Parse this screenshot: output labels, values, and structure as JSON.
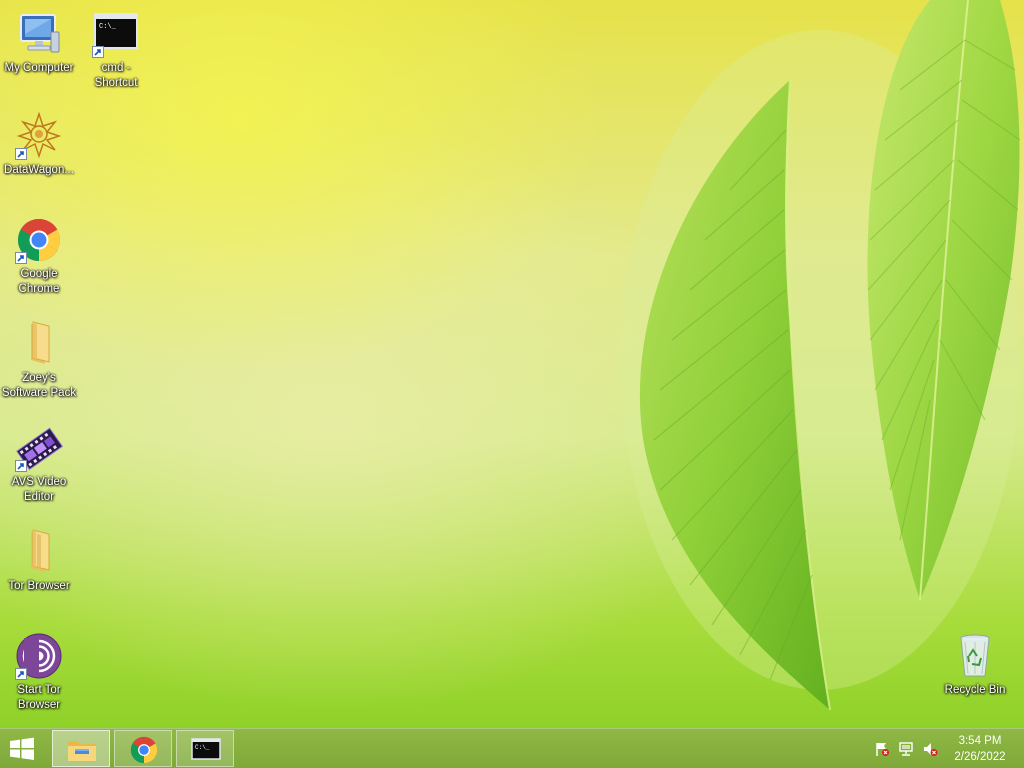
{
  "desktop": {
    "icons": [
      {
        "label": "My Computer",
        "icon": "computer-icon"
      },
      {
        "label": "cmd - Shortcut",
        "icon": "cmd-icon"
      },
      {
        "label": "DataWagon...",
        "icon": "datawagon-icon"
      },
      {
        "label": "Google Chrome",
        "icon": "chrome-icon"
      },
      {
        "label": "Zoey's Software Pack",
        "icon": "folder-icon"
      },
      {
        "label": "AVS Video Editor",
        "icon": "film-icon"
      },
      {
        "label": "Tor Browser",
        "icon": "folder-icon"
      },
      {
        "label": "Start Tor Browser",
        "icon": "tor-icon"
      },
      {
        "label": "Recycle Bin",
        "icon": "recycle-bin-icon"
      }
    ],
    "cmd_prompt_glyph": "C:\\_"
  },
  "taskbar": {
    "start": {
      "icon": "windows-logo-icon"
    },
    "pinned": [
      {
        "name": "File Explorer",
        "icon": "file-explorer-icon",
        "active": true
      },
      {
        "name": "Google Chrome",
        "icon": "chrome-icon",
        "active": false
      },
      {
        "name": "Command Prompt",
        "icon": "cmd-icon",
        "active": false
      }
    ],
    "tray": {
      "icons": [
        "action-center-flag-icon",
        "network-icon",
        "volume-muted-icon"
      ],
      "time": "3:54 PM",
      "date": "2/26/2022"
    }
  },
  "colors": {
    "taskbar": "#86b03f",
    "wallpaper_top": "#e6e24a",
    "wallpaper_bottom": "#8fd128",
    "leaf": "#8fd23a"
  }
}
